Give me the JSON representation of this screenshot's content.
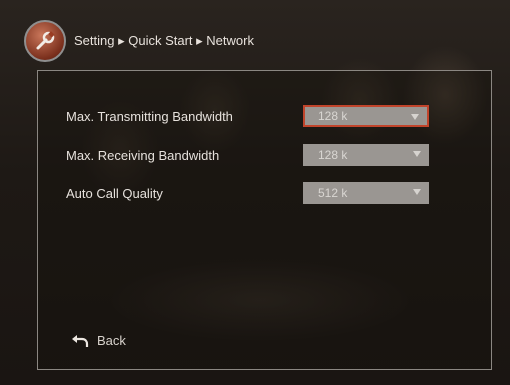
{
  "breadcrumb": {
    "text": "Setting ▸ Quick Start ▸ Network"
  },
  "settings": [
    {
      "label": "Max. Transmitting Bandwidth",
      "value": "128 k",
      "focused": true
    },
    {
      "label": "Max. Receiving Bandwidth",
      "value": "128 k",
      "focused": false
    },
    {
      "label": "Auto Call Quality",
      "value": "512 k",
      "focused": false
    }
  ],
  "back": {
    "label": "Back"
  },
  "colors": {
    "focus_border": "#c1442b",
    "select_bg": "#9a9692",
    "text": "#e6e1dc"
  },
  "icons": {
    "title": "wrench-icon",
    "back": "return-arrow-icon",
    "dropdown": "chevron-down-icon"
  }
}
